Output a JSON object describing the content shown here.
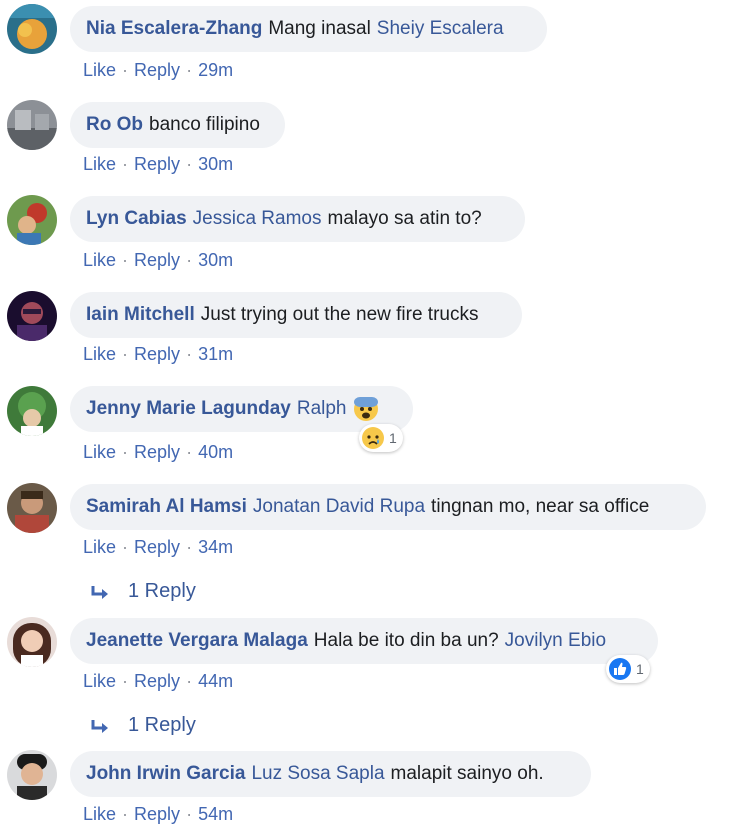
{
  "comments": [
    {
      "author": "Nia Escalera-Zhang",
      "text": "Mang inasal",
      "mention_after": "Sheiy Escalera",
      "time": "29m"
    },
    {
      "author": "Ro Ob",
      "text": "banco filipino",
      "time": "30m"
    },
    {
      "author": "Lyn Cabias",
      "mention": "Jessica Ramos",
      "text": "malayo sa atin to?",
      "time": "30m"
    },
    {
      "author": "Iain Mitchell",
      "text": "Just trying out the new fire trucks",
      "time": "31m"
    },
    {
      "author": "Jenny Marie Lagunday",
      "mention": "Ralph",
      "emoji": "fearful-face-icon",
      "time": "40m",
      "reaction": {
        "icon": "sad-face-icon",
        "count": "1"
      }
    },
    {
      "author": "Samirah Al Hamsi",
      "mention": "Jonatan David Rupa",
      "text": "tingnan mo, near sa office",
      "time": "34m",
      "replies": "1 Reply"
    },
    {
      "author": "Jeanette Vergara Malaga",
      "text": "Hala be ito din ba un?",
      "mention_after": "Jovilyn Ebio",
      "time": "44m",
      "reaction": {
        "icon": "like-icon",
        "count": "1"
      },
      "replies": "1 Reply"
    },
    {
      "author": "John Irwin Garcia",
      "mention": "Luz Sosa Sapla",
      "text": "malapit sainyo oh.",
      "time": "54m"
    }
  ],
  "actions": {
    "like": "Like",
    "reply": "Reply",
    "separator": "·"
  },
  "colors": {
    "name": "#385898",
    "action": "#4267b2",
    "bubble": "#f0f2f5"
  }
}
